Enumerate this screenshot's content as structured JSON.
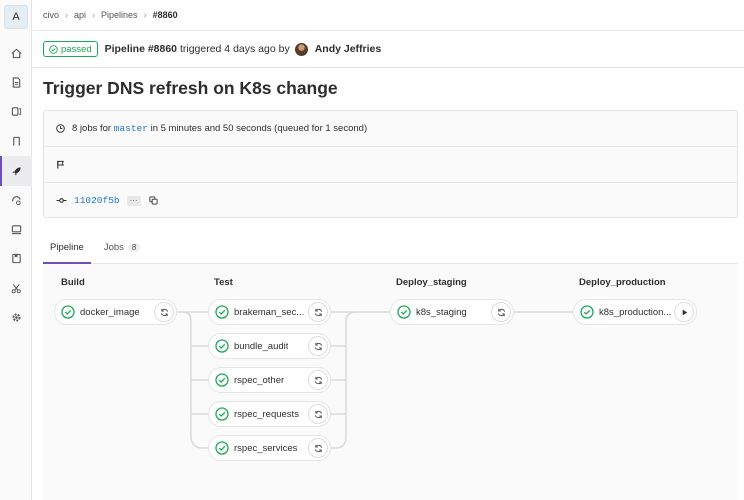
{
  "project_avatar": "A",
  "breadcrumb": [
    "civo",
    "api",
    "Pipelines",
    "#8860"
  ],
  "header": {
    "status": "passed",
    "pipeline_label": "Pipeline #8860",
    "triggered_text": "triggered 4 days ago by",
    "author": "Andy Jeffries"
  },
  "title": "Trigger DNS refresh on K8s change",
  "info": {
    "jobs_prefix": "8 jobs for",
    "branch": "master",
    "duration_text": "in 5 minutes and 50 seconds (queued for 1 second)",
    "commit_sha": "11020f5b",
    "ellipsis": "···"
  },
  "tabs": [
    {
      "label": "Pipeline",
      "active": true
    },
    {
      "label": "Jobs",
      "count": "8",
      "active": false
    }
  ],
  "stages": [
    {
      "name": "Build",
      "jobs": [
        {
          "name": "docker_image",
          "action": "retry-icon"
        }
      ]
    },
    {
      "name": "Test",
      "jobs": [
        {
          "name": "brakeman_sec...",
          "action": "retry-icon"
        },
        {
          "name": "bundle_audit",
          "action": "retry-icon"
        },
        {
          "name": "rspec_other",
          "action": "retry-icon"
        },
        {
          "name": "rspec_requests",
          "action": "retry-icon"
        },
        {
          "name": "rspec_services",
          "action": "retry-icon"
        }
      ]
    },
    {
      "name": "Deploy_staging",
      "jobs": [
        {
          "name": "k8s_staging",
          "action": "retry-icon"
        }
      ]
    },
    {
      "name": "Deploy_production",
      "jobs": [
        {
          "name": "k8s_production...",
          "action": "play-icon"
        }
      ]
    }
  ],
  "sidebar_icons": [
    "home-icon",
    "repository-icon",
    "issues-icon",
    "merge-request-icon",
    "rocket-icon",
    "operations-icon",
    "monitor-icon",
    "wiki-icon",
    "snippets-icon",
    "settings-icon"
  ],
  "colors": {
    "success": "#1aaa55",
    "accent": "#6b4fbb",
    "link": "#1f78d1"
  }
}
